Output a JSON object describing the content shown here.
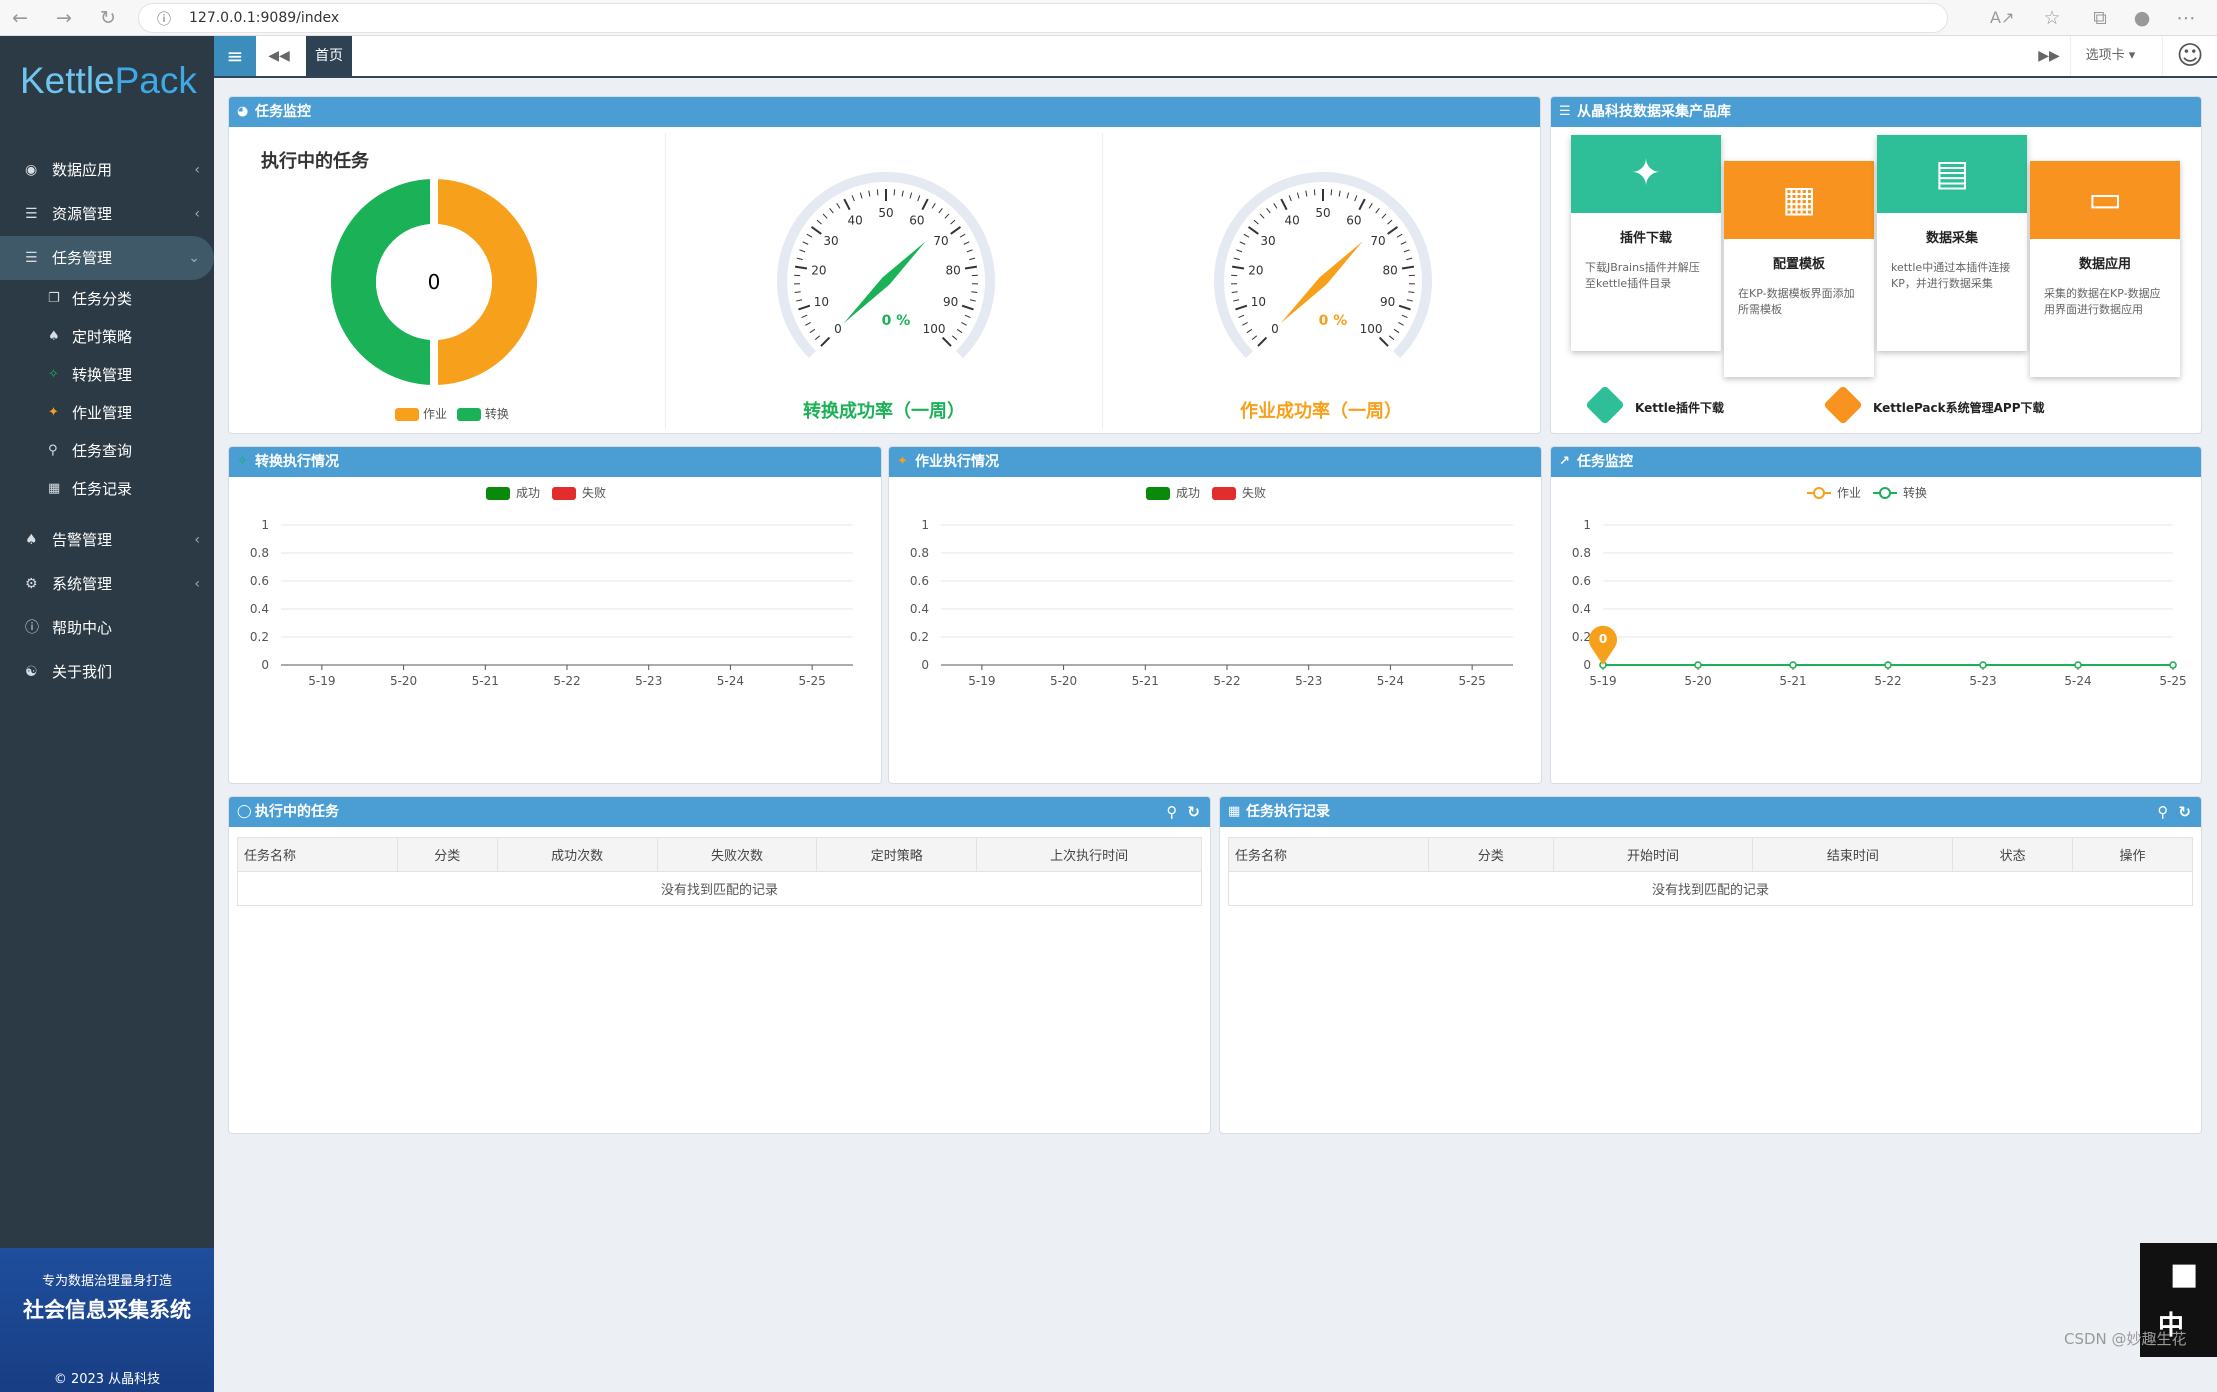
{
  "browser": {
    "url": "127.0.0.1:9089/index"
  },
  "sidebar": {
    "logo": {
      "kettle": "Kettle",
      "pack": "Pack"
    },
    "items": [
      {
        "label": "数据应用",
        "icon": "palette-icon"
      },
      {
        "label": "资源管理",
        "icon": "database-icon"
      },
      {
        "label": "任务管理",
        "icon": "list-icon"
      },
      {
        "label": "告警管理",
        "icon": "bell-icon"
      },
      {
        "label": "系统管理",
        "icon": "cogs-icon"
      },
      {
        "label": "帮助中心",
        "icon": "question-icon"
      },
      {
        "label": "关于我们",
        "icon": "handshake-icon"
      }
    ],
    "subitems": [
      {
        "label": "任务分类",
        "icon": "copy-icon"
      },
      {
        "label": "定时策略",
        "icon": "bell-icon"
      },
      {
        "label": "转换管理",
        "icon": "shuffle-icon"
      },
      {
        "label": "作业管理",
        "icon": "puzzle-icon"
      },
      {
        "label": "任务查询",
        "icon": "search-icon"
      },
      {
        "label": "任务记录",
        "icon": "calendar-icon"
      }
    ],
    "banner": {
      "line1": "专为数据治理量身打造",
      "line2": "社会信息采集系统",
      "copyright": "© 2023 从晶科技"
    }
  },
  "topbar": {
    "home_tab": "首页",
    "options": "选项卡"
  },
  "monitor": {
    "title": "任务监控",
    "running_title": "执行中的任务",
    "running_count": "0",
    "legend": [
      "作业",
      "转换"
    ],
    "gauge1": {
      "value": "0 %",
      "label": "转换成功率（一周）",
      "color": "#1ab157"
    },
    "gauge2": {
      "value": "0 %",
      "label": "作业成功率（一周）",
      "color": "#f7a01b"
    },
    "gauge_ticks": [
      "0",
      "10",
      "20",
      "30",
      "40",
      "50",
      "60",
      "70",
      "80",
      "90",
      "100"
    ]
  },
  "products": {
    "title": "从晶科技数据采集产品库",
    "cards": [
      {
        "title": "插件下载",
        "desc": "下载JBrains插件并解压至kettle插件目录",
        "color": "#2ebf98"
      },
      {
        "title": "配置模板",
        "desc": "在KP-数据模板界面添加所需模板",
        "color": "#f7931e"
      },
      {
        "title": "数据采集",
        "desc": "kettle中通过本插件连接KP，并进行数据采集",
        "color": "#2ebf98"
      },
      {
        "title": "数据应用",
        "desc": "采集的数据在KP-数据应用界面进行数据应用",
        "color": "#f7931e"
      }
    ],
    "download1": "Kettle插件下载",
    "download2": "KettlePack系统管理APP下载"
  },
  "chart_data": [
    {
      "type": "bar",
      "title": "转换执行情况",
      "categories": [
        "5-19",
        "5-20",
        "5-21",
        "5-22",
        "5-23",
        "5-24",
        "5-25"
      ],
      "series": [
        {
          "name": "成功",
          "values": [
            0,
            0,
            0,
            0,
            0,
            0,
            0
          ],
          "color": "#0a8a0a"
        },
        {
          "name": "失败",
          "values": [
            0,
            0,
            0,
            0,
            0,
            0,
            0
          ],
          "color": "#e32c2c"
        }
      ],
      "ylim": [
        0,
        1
      ],
      "yticks": [
        "0",
        "0.2",
        "0.4",
        "0.6",
        "0.8",
        "1"
      ],
      "legend": "top-center",
      "grid": true
    },
    {
      "type": "bar",
      "title": "作业执行情况",
      "categories": [
        "5-19",
        "5-20",
        "5-21",
        "5-22",
        "5-23",
        "5-24",
        "5-25"
      ],
      "series": [
        {
          "name": "成功",
          "values": [
            0,
            0,
            0,
            0,
            0,
            0,
            0
          ],
          "color": "#0a8a0a"
        },
        {
          "name": "失败",
          "values": [
            0,
            0,
            0,
            0,
            0,
            0,
            0
          ],
          "color": "#e32c2c"
        }
      ],
      "ylim": [
        0,
        1
      ],
      "yticks": [
        "0",
        "0.2",
        "0.4",
        "0.6",
        "0.8",
        "1"
      ],
      "legend": "top-center",
      "grid": true
    },
    {
      "type": "line",
      "title": "任务监控",
      "categories": [
        "5-19",
        "5-20",
        "5-21",
        "5-22",
        "5-23",
        "5-24",
        "5-25"
      ],
      "series": [
        {
          "name": "作业",
          "values": [
            0,
            0,
            0,
            0,
            0,
            0,
            0
          ],
          "color": "#f7a01b"
        },
        {
          "name": "转换",
          "values": [
            0,
            0,
            0,
            0,
            0,
            0,
            0
          ],
          "color": "#1ab157"
        }
      ],
      "ylim": [
        0,
        1
      ],
      "yticks": [
        "0",
        "0.2",
        "0.4",
        "0.6",
        "0.8",
        "1"
      ],
      "legend": "top-center",
      "grid": true,
      "marker_label": "0"
    }
  ],
  "running_tasks": {
    "title": "执行中的任务",
    "columns": [
      "任务名称",
      "分类",
      "成功次数",
      "失败次数",
      "定时策略",
      "上次执行时间"
    ],
    "empty": "没有找到匹配的记录"
  },
  "task_records": {
    "title": "任务执行记录",
    "columns": [
      "任务名称",
      "分类",
      "开始时间",
      "结束时间",
      "状态",
      "操作"
    ],
    "empty": "没有找到匹配的记录"
  },
  "watermark": "CSDN @妙趣生花"
}
